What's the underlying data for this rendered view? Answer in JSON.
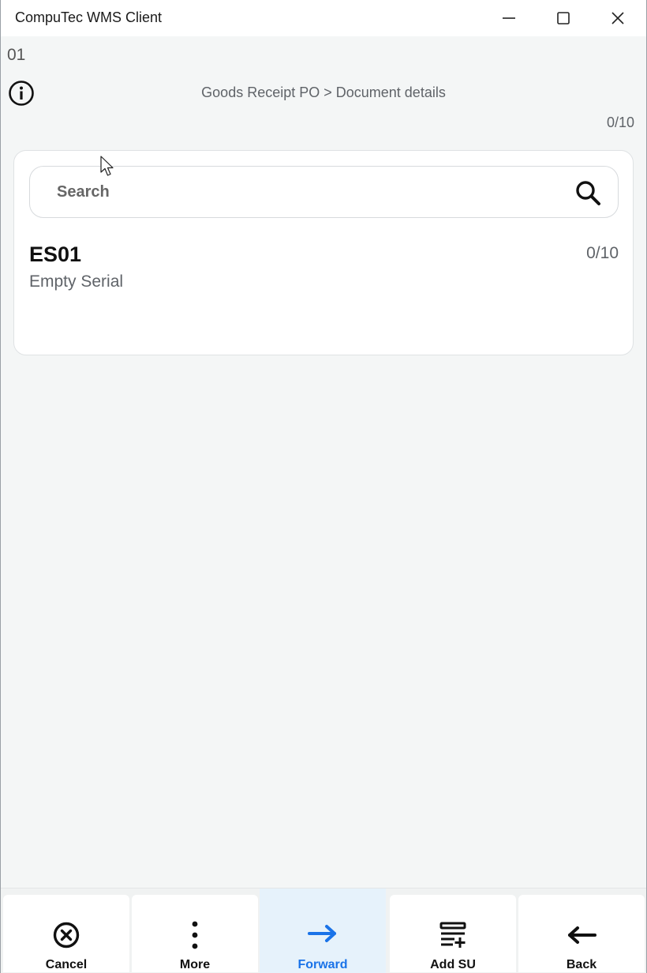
{
  "window": {
    "title": "CompuTec WMS Client"
  },
  "header": {
    "code": "01",
    "breadcrumb": "Goods Receipt PO > Document details",
    "counter": "0/10"
  },
  "search": {
    "placeholder": "Search",
    "value": ""
  },
  "items": [
    {
      "code": "ES01",
      "description": "Empty Serial",
      "count": "0/10"
    }
  ],
  "toolbar": {
    "cancel_label": "Cancel",
    "more_label": "More",
    "forward_label": "Forward",
    "add_su_label": "Add SU",
    "back_label": "Back"
  },
  "colors": {
    "accent": "#1a73e8",
    "active_bg": "#e6f2fb",
    "background": "#f4f6f6"
  }
}
